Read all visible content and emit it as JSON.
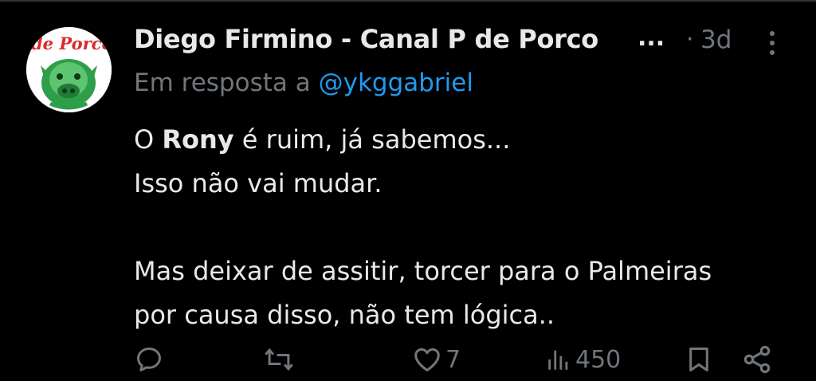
{
  "tweet": {
    "author_name": "Diego Firmino - Canal P de Porco",
    "name_ellipsis": "...",
    "separator": "·",
    "time_ago": "3d",
    "avatar_text": "de Porco",
    "reply_prefix": "Em resposta a",
    "reply_handle": "@ykggabriel",
    "body": {
      "line1_pre": "O ",
      "line1_bold": "Rony",
      "line1_post": " é ruim, já sabemos...",
      "line2": "Isso não vai mudar.",
      "line3": "Mas deixar de assitir, torcer para o Palmeiras",
      "line4": "por causa disso, não tem lógica.."
    },
    "actions": {
      "reply_count": "",
      "retweet_count": "",
      "like_count": "7",
      "views_count": "450"
    }
  },
  "colors": {
    "background": "#000000",
    "text_primary": "#e7e9ea",
    "text_secondary": "#71767b",
    "link": "#1d9bf0",
    "avatar_green": "#2e9e4a",
    "avatar_red": "#d92b2b"
  },
  "icons": [
    "avatar-logo",
    "more-options-icon",
    "reply-icon",
    "retweet-icon",
    "like-heart-icon",
    "views-chart-icon",
    "bookmark-icon",
    "share-icon"
  ]
}
